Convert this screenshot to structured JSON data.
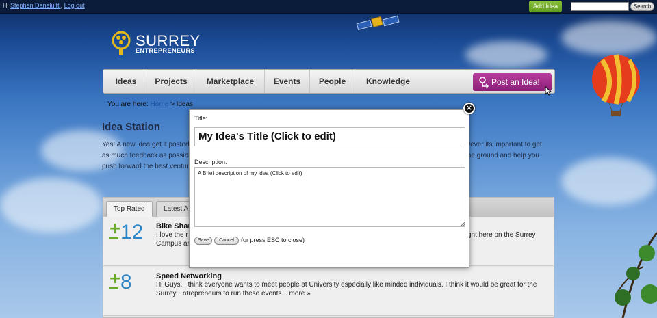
{
  "topbar": {
    "greeting_prefix": "Hi",
    "user_name": "Stephen Daneluitti",
    "logout_label": "Log out",
    "add_idea_label": "Add Idea",
    "search_placeholder": "",
    "search_button_label": "Search"
  },
  "logo": {
    "title": "SURREY",
    "subtitle": "ENTREPRENEURS"
  },
  "nav": {
    "items": [
      {
        "label": "Ideas"
      },
      {
        "label": "Projects"
      },
      {
        "label": "Marketplace"
      },
      {
        "label": "Events"
      },
      {
        "label": "People"
      },
      {
        "label": "Knowledge"
      }
    ],
    "post_label": "Post an Idea!"
  },
  "breadcrumb": {
    "prefix": "You are here:",
    "home_label": "Home",
    "separator": ">",
    "current": "Ideas"
  },
  "page": {
    "title": "Idea Station",
    "intro_line1_left": "Yes! A new idea get it posted",
    "intro_line1_right": "wever its important to get",
    "intro_line2_left": "as much feedback as possible",
    "intro_line2_right": "the ground and help you",
    "intro_line3_left": "push forward the best ventur"
  },
  "tabs": [
    {
      "label": "Top Rated"
    },
    {
      "label": "Latest A"
    }
  ],
  "ideas": [
    {
      "votes": "12",
      "title": "Bike Shar",
      "desc_line1_left": "I love the r",
      "desc_line1_right": "ght here on the Surrey",
      "desc_line2": "Campus ar"
    },
    {
      "votes": "8",
      "title": "Speed Networking",
      "desc_line1": "Hi Guys,  I think everyone wants to meet people at University especially like minded individuals.  I think it would be great for the",
      "desc_line2": "Surrey Entrepreneurs to run these events... more »"
    }
  ],
  "modal": {
    "title_label": "Title:",
    "title_value": "My Idea's Title (Click to edit)",
    "description_label": "Description:",
    "description_value": "A Brief description of my idea (Click to edit)",
    "save_label": "Save",
    "cancel_label": "Cancel",
    "hint": "(or press ESC to close)",
    "close_glyph": "×"
  },
  "colors": {
    "accent_green": "#6aaa2a",
    "vote_blue": "#2f86c6",
    "post_button": "#a0308a",
    "add_idea_green": "#7cb631"
  }
}
